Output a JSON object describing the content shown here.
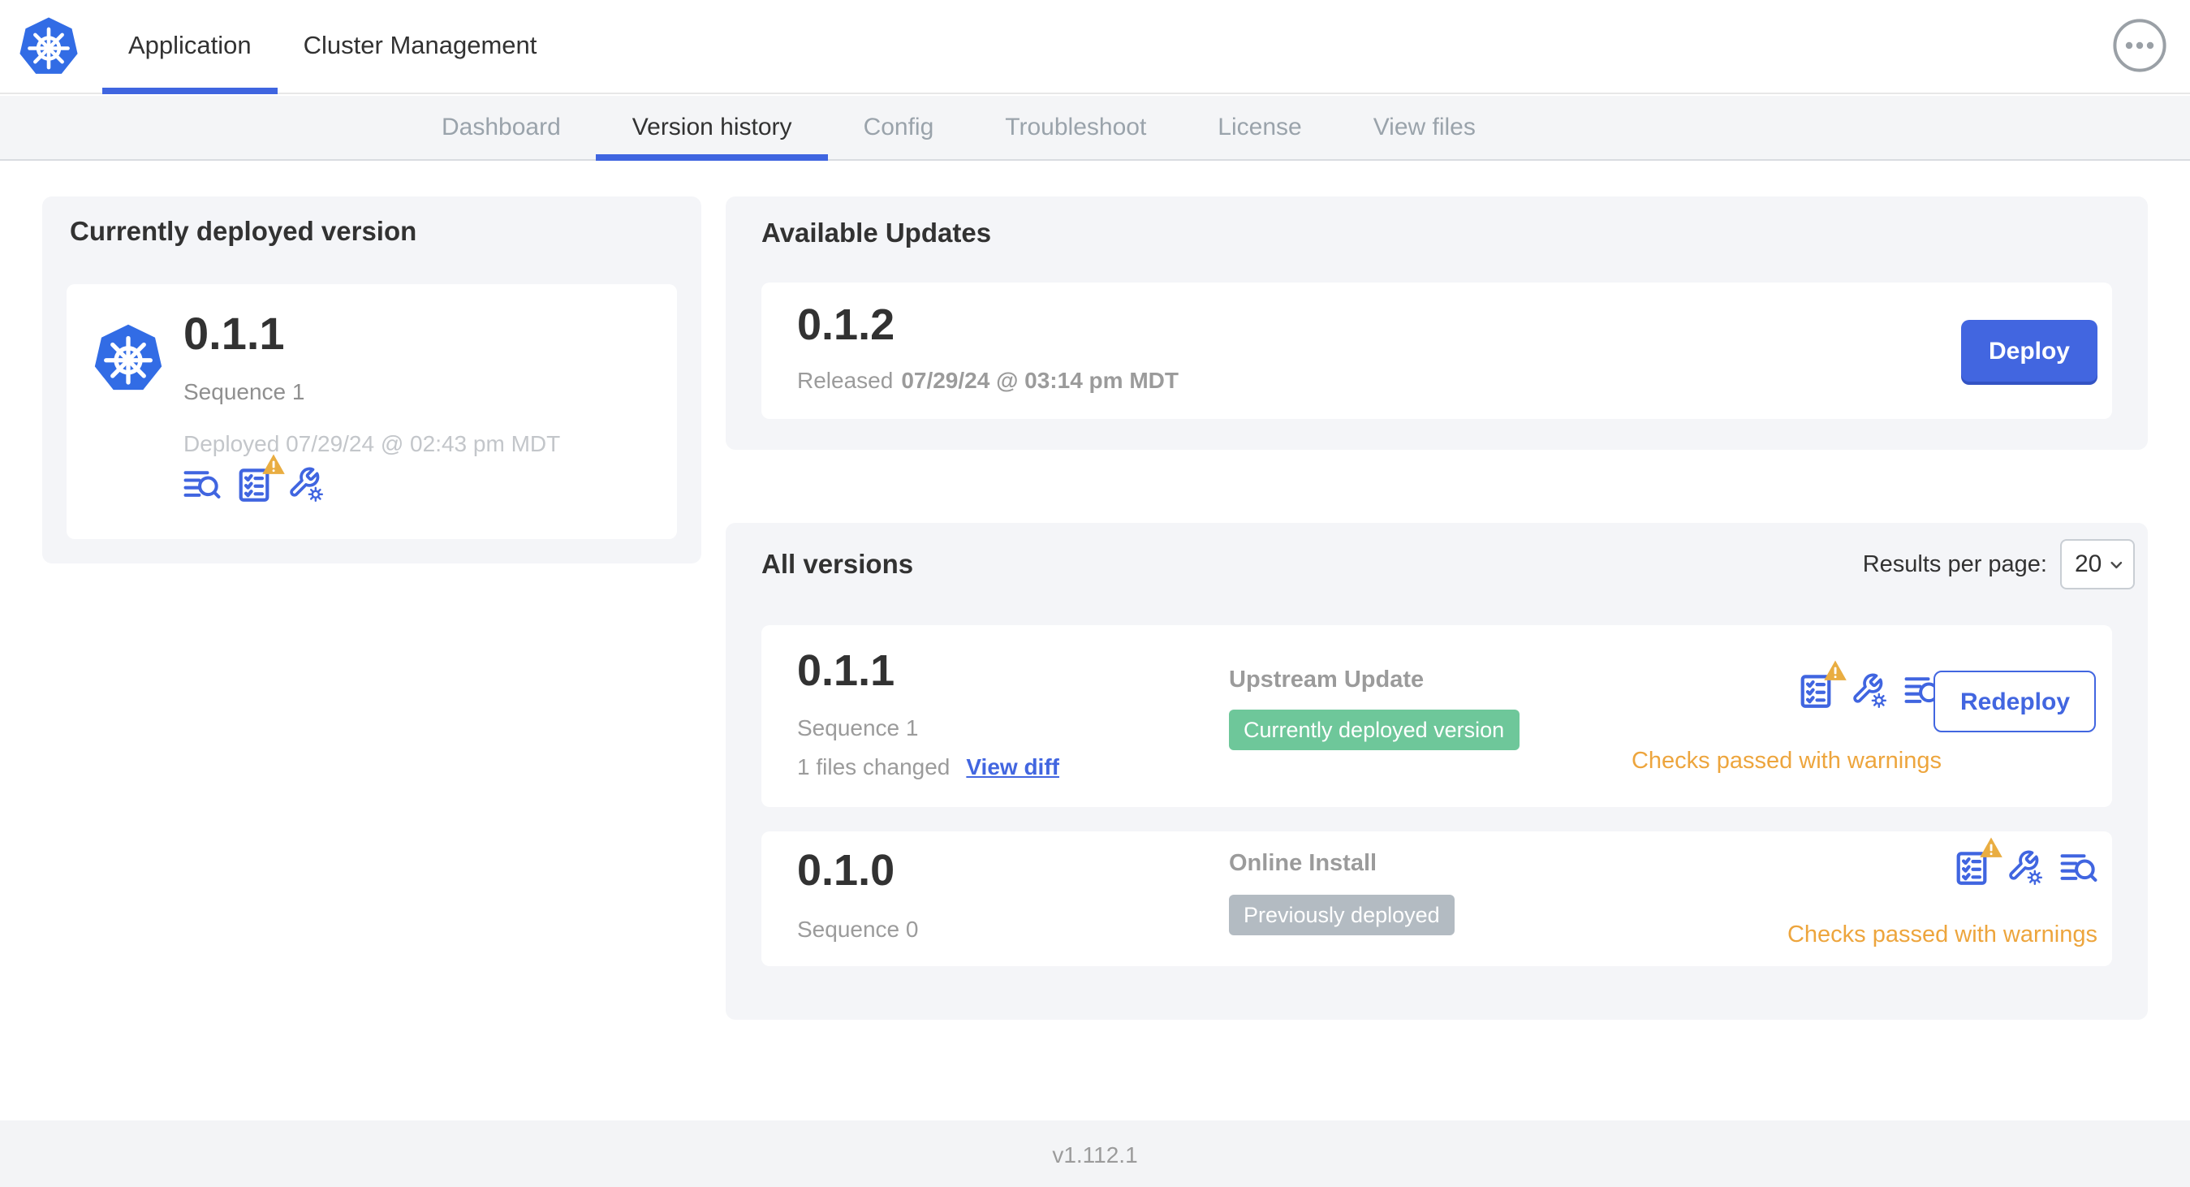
{
  "header": {
    "tabs": [
      {
        "label": "Application"
      },
      {
        "label": "Cluster Management"
      }
    ]
  },
  "nav": {
    "tabs": [
      "Dashboard",
      "Version history",
      "Config",
      "Troubleshoot",
      "License",
      "View files"
    ],
    "active": "Version history"
  },
  "current": {
    "title": "Currently deployed version",
    "version": "0.1.1",
    "sequence": "Sequence 1",
    "deployed": "Deployed 07/29/24 @ 02:43 pm MDT"
  },
  "updates": {
    "title": "Available Updates",
    "version": "0.1.2",
    "released_prefix": "Released",
    "released_date": "07/29/24 @ 03:14 pm MDT",
    "deploy_label": "Deploy"
  },
  "versions": {
    "title": "All versions",
    "results_label": "Results per page:",
    "results_value": "20",
    "rows": [
      {
        "version": "0.1.1",
        "sequence": "Sequence 1",
        "files_changed": "1 files changed",
        "view_diff": "View diff",
        "source": "Upstream Update",
        "badge": "Currently deployed version",
        "badge_color": "green",
        "status": "Checks passed with warnings",
        "action": "Redeploy"
      },
      {
        "version": "0.1.0",
        "sequence": "Sequence 0",
        "source": "Online Install",
        "badge": "Previously deployed",
        "badge_color": "gray",
        "status": "Checks passed with warnings"
      }
    ]
  },
  "footer": {
    "version": "v1.112.1"
  },
  "colors": {
    "accent_blue": "#4266e0",
    "k8s_blue": "#326ce5",
    "green_badge": "#6ec79a",
    "gray_badge": "#b3bbc2",
    "warning_orange": "#eda53d",
    "warning_triangle": "#e9ad41",
    "panel_bg": "#f4f5f8"
  }
}
